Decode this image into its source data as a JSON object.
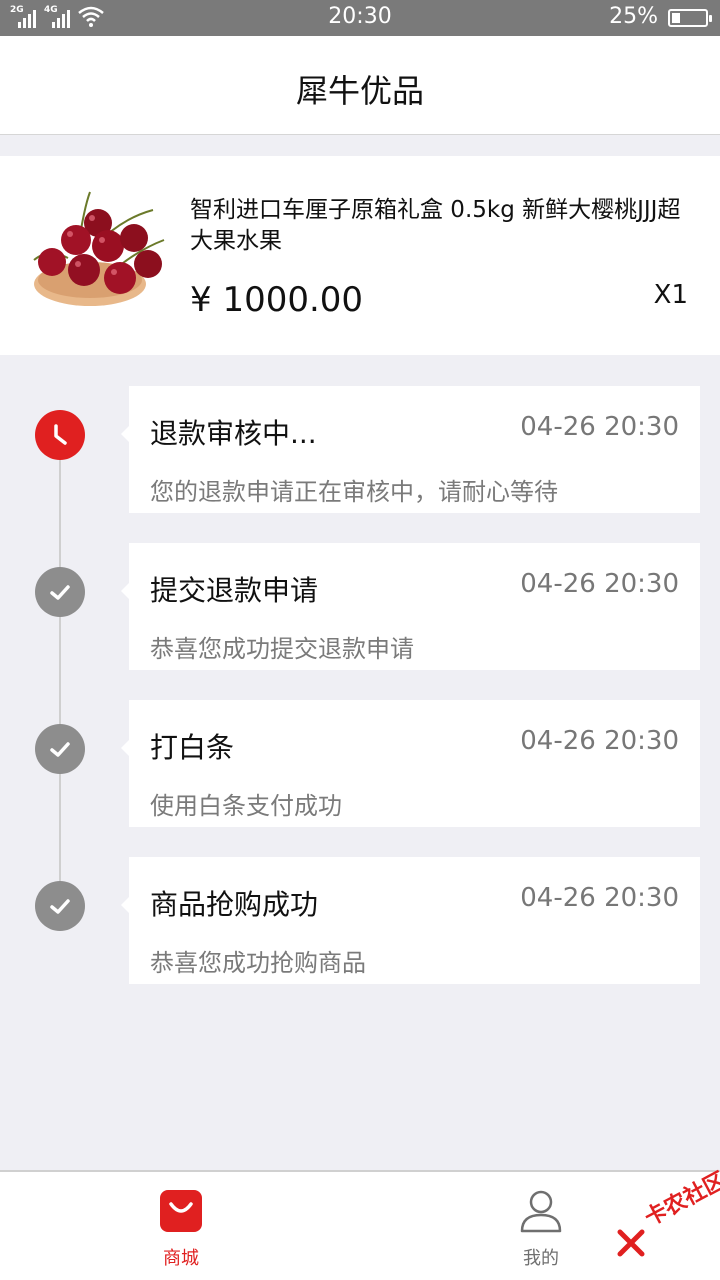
{
  "status_bar": {
    "net1": "2G",
    "net2": "4G",
    "time": "20:30",
    "battery_pct": "25%",
    "battery_level": 0.25
  },
  "header": {
    "title": "犀牛优品"
  },
  "product": {
    "name": "智利进口车厘子原箱礼盒 0.5kg 新鲜大樱桃JJJ超大果水果",
    "price": "¥ 1000.00",
    "qty": "X1",
    "image_icon": "cherries-image"
  },
  "steps": [
    {
      "title": "退款审核中...",
      "time": "04-26 20:30",
      "desc": "您的退款申请正在审核中，请耐心等待",
      "icon": "clock-icon",
      "active": true
    },
    {
      "title": "提交退款申请",
      "time": "04-26 20:30",
      "desc": "恭喜您成功提交退款申请",
      "icon": "check-icon",
      "active": false
    },
    {
      "title": "打白条",
      "time": "04-26 20:30",
      "desc": "使用白条支付成功",
      "icon": "check-icon",
      "active": false
    },
    {
      "title": "商品抢购成功",
      "time": "04-26 20:30",
      "desc": "恭喜您成功抢购商品",
      "icon": "check-icon",
      "active": false
    }
  ],
  "tabbar": {
    "shop_label": "商城",
    "mine_label": "我的"
  },
  "watermark": {
    "text": "卡农社区"
  },
  "colors": {
    "accent": "#e02020",
    "inactive": "#8d8d8d",
    "background": "#efeff4"
  }
}
